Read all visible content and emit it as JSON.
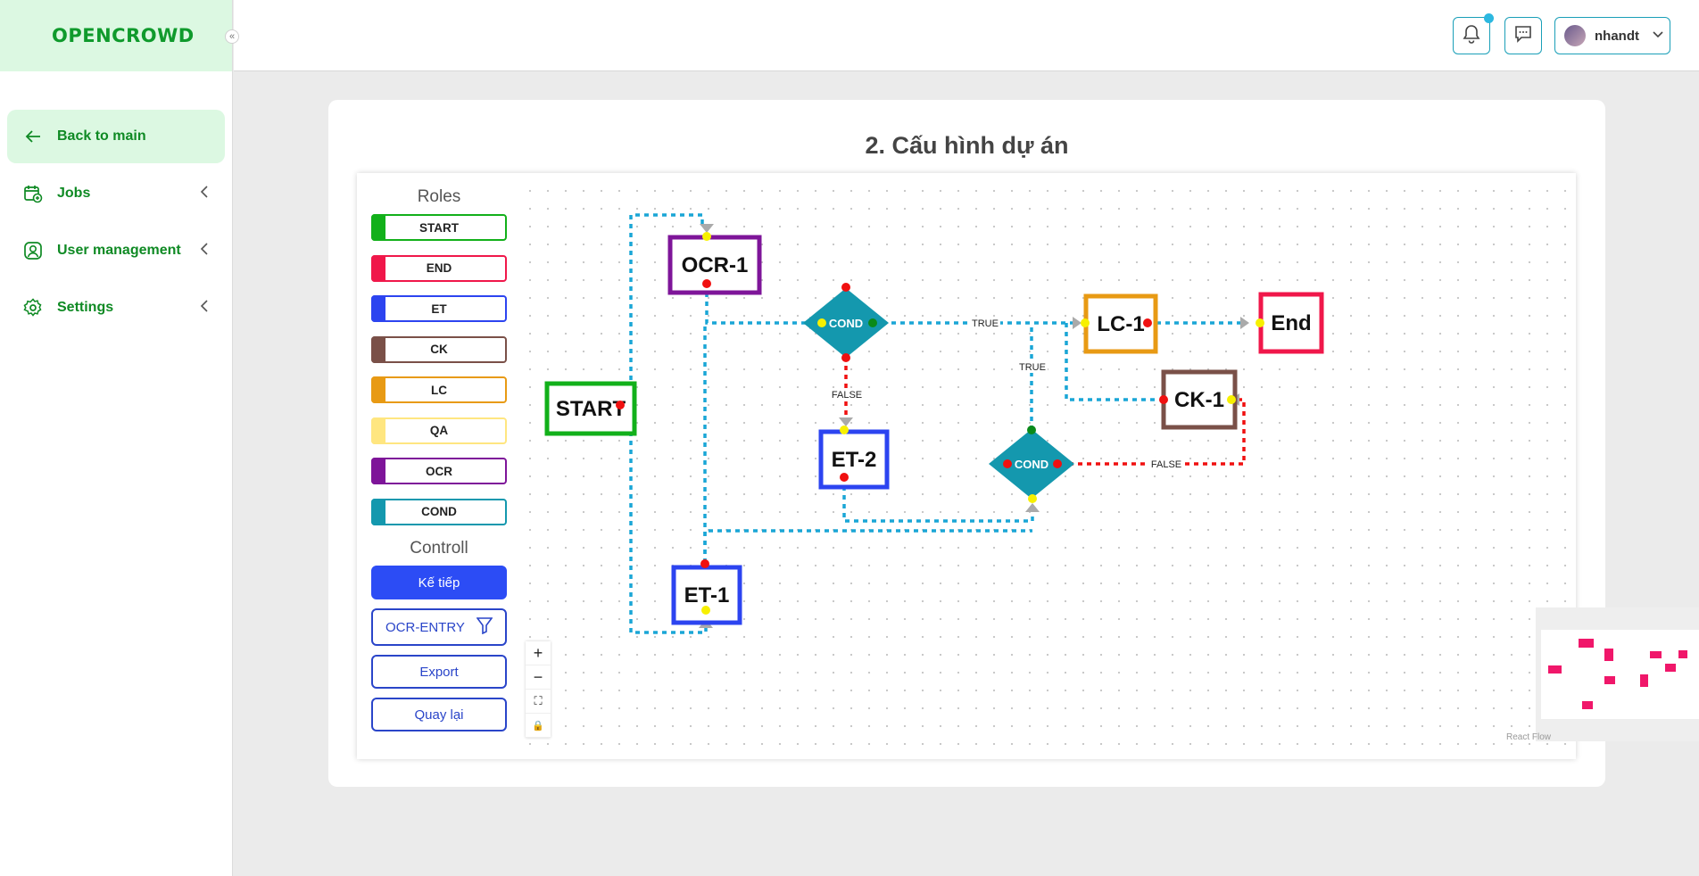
{
  "brand": "OPENCROWD",
  "sidebar": {
    "collapse": "«",
    "items": [
      {
        "label": "Back to main"
      },
      {
        "label": "Jobs"
      },
      {
        "label": "User management"
      },
      {
        "label": "Settings"
      }
    ]
  },
  "header": {
    "username": "nhandt"
  },
  "page": {
    "title": "2. Cấu hình dự án",
    "roles_title": "Roles",
    "roles": [
      {
        "label": "START",
        "color": "#12b01a"
      },
      {
        "label": "END",
        "color": "#f0174a"
      },
      {
        "label": "ET",
        "color": "#2c44f0"
      },
      {
        "label": "CK",
        "color": "#7a5048"
      },
      {
        "label": "LC",
        "color": "#e89a14"
      },
      {
        "label": "QA",
        "color": "#ffe680"
      },
      {
        "label": "OCR",
        "color": "#7e1599"
      },
      {
        "label": "COND",
        "color": "#1498ae"
      }
    ],
    "control_title": "Controll",
    "controls": {
      "next": "Kế tiếp",
      "filter_value": "OCR-ENTRY",
      "export": "Export",
      "back": "Quay lại"
    }
  },
  "flow": {
    "nodes": {
      "start": "START",
      "ocr1": "OCR-1",
      "cond1": "COND",
      "et2": "ET-2",
      "lc1": "LC-1",
      "end": "End",
      "ck1": "CK-1",
      "cond2": "COND",
      "et1": "ET-1"
    },
    "edge_labels": {
      "true1": "TRUE",
      "true2": "TRUE",
      "false1": "FALSE",
      "false2": "FALSE"
    },
    "zoom_controls": [
      "+",
      "−",
      "⛶",
      "🔒"
    ],
    "attribution": "React Flow"
  }
}
